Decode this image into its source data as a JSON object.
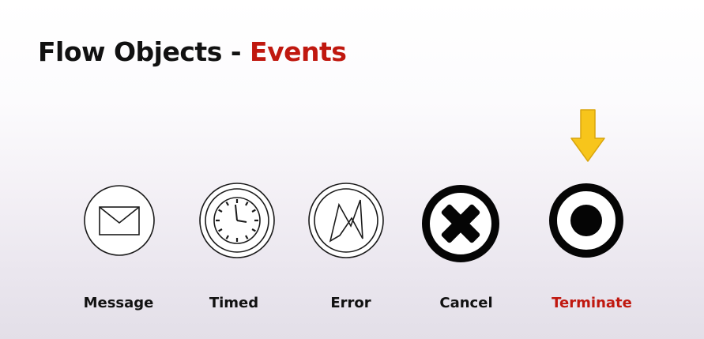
{
  "slide": {
    "title_main": "Flow Objects - ",
    "title_accent": "Events"
  },
  "events": [
    {
      "label": "Message",
      "icon": "envelope-icon"
    },
    {
      "label": "Timed",
      "icon": "clock-icon"
    },
    {
      "label": "Error",
      "icon": "lightning-icon"
    },
    {
      "label": "Cancel",
      "icon": "x-icon"
    },
    {
      "label": "Terminate",
      "icon": "filled-circle-icon"
    }
  ],
  "highlight": {
    "event": "Terminate",
    "marker": "down-arrow-icon"
  },
  "colors": {
    "accent": "#c0180f",
    "arrow": "#f7c51b",
    "text": "#111111"
  }
}
